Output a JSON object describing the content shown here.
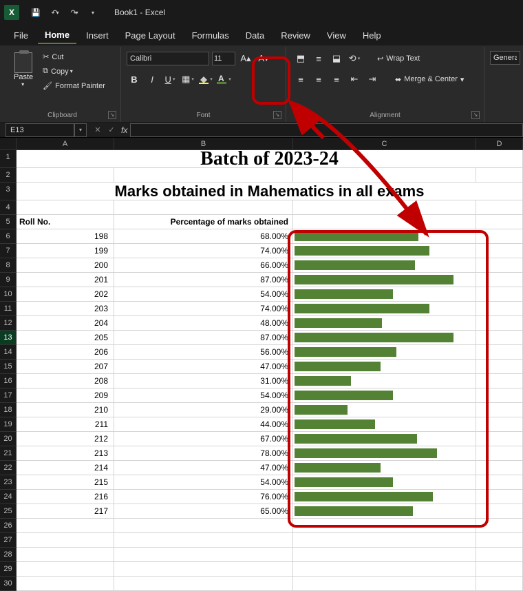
{
  "titlebar": {
    "app_glyph": "X",
    "doc_title": "Book1 - Excel"
  },
  "menu": {
    "items": [
      "File",
      "Home",
      "Insert",
      "Page Layout",
      "Formulas",
      "Data",
      "Review",
      "View",
      "Help"
    ],
    "active_index": 1
  },
  "ribbon": {
    "clipboard": {
      "label": "Clipboard",
      "paste": "Paste",
      "cut": "Cut",
      "copy": "Copy",
      "format_painter": "Format Painter"
    },
    "font": {
      "label": "Font",
      "family": "Calibri",
      "size": "11",
      "bold": "B",
      "italic": "I",
      "underline": "U"
    },
    "alignment": {
      "label": "Alignment",
      "wrap_text": "Wrap Text",
      "merge_center": "Merge & Center"
    },
    "number": {
      "format": "General"
    }
  },
  "formula_bar": {
    "name_box": "E13",
    "fx": "fx",
    "value": ""
  },
  "columns": [
    "A",
    "B",
    "C",
    "D"
  ],
  "sheet": {
    "title_line1": "Batch of 2023-24",
    "title_line2": "Marks obtained in Mahematics in all exams",
    "header_a": "Roll No.",
    "header_b": "Percentage of marks obtained"
  },
  "chart_data": {
    "type": "bar",
    "title": "Percentage of marks obtained",
    "xlabel": "Roll No.",
    "ylabel": "Percentage",
    "ylim": [
      0,
      100
    ],
    "categories": [
      198,
      199,
      200,
      201,
      202,
      203,
      204,
      205,
      206,
      207,
      208,
      209,
      210,
      211,
      212,
      213,
      214,
      215,
      216,
      217
    ],
    "values": [
      68.0,
      74.0,
      66.0,
      87.0,
      54.0,
      74.0,
      48.0,
      87.0,
      56.0,
      47.0,
      31.0,
      54.0,
      29.0,
      44.0,
      67.0,
      78.0,
      47.0,
      54.0,
      76.0,
      65.0
    ]
  },
  "row_start": 6,
  "selected_row": 13,
  "total_rows": 30
}
